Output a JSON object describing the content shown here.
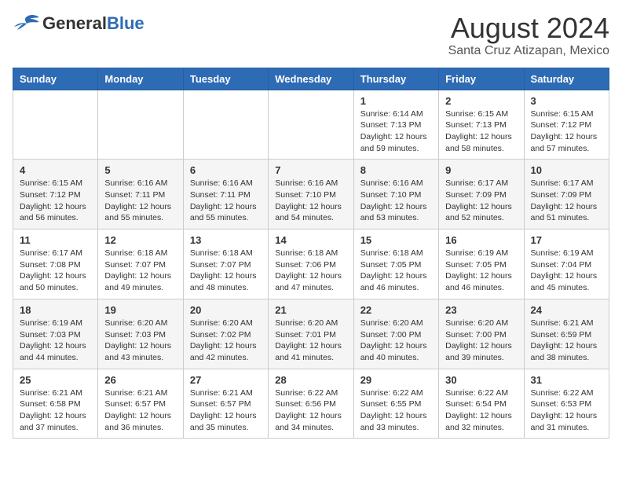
{
  "header": {
    "logo_general": "General",
    "logo_blue": "Blue",
    "month_year": "August 2024",
    "location": "Santa Cruz Atizapan, Mexico"
  },
  "weekdays": [
    "Sunday",
    "Monday",
    "Tuesday",
    "Wednesday",
    "Thursday",
    "Friday",
    "Saturday"
  ],
  "weeks": [
    [
      {
        "day": "",
        "info": ""
      },
      {
        "day": "",
        "info": ""
      },
      {
        "day": "",
        "info": ""
      },
      {
        "day": "",
        "info": ""
      },
      {
        "day": "1",
        "info": "Sunrise: 6:14 AM\nSunset: 7:13 PM\nDaylight: 12 hours\nand 59 minutes."
      },
      {
        "day": "2",
        "info": "Sunrise: 6:15 AM\nSunset: 7:13 PM\nDaylight: 12 hours\nand 58 minutes."
      },
      {
        "day": "3",
        "info": "Sunrise: 6:15 AM\nSunset: 7:12 PM\nDaylight: 12 hours\nand 57 minutes."
      }
    ],
    [
      {
        "day": "4",
        "info": "Sunrise: 6:15 AM\nSunset: 7:12 PM\nDaylight: 12 hours\nand 56 minutes."
      },
      {
        "day": "5",
        "info": "Sunrise: 6:16 AM\nSunset: 7:11 PM\nDaylight: 12 hours\nand 55 minutes."
      },
      {
        "day": "6",
        "info": "Sunrise: 6:16 AM\nSunset: 7:11 PM\nDaylight: 12 hours\nand 55 minutes."
      },
      {
        "day": "7",
        "info": "Sunrise: 6:16 AM\nSunset: 7:10 PM\nDaylight: 12 hours\nand 54 minutes."
      },
      {
        "day": "8",
        "info": "Sunrise: 6:16 AM\nSunset: 7:10 PM\nDaylight: 12 hours\nand 53 minutes."
      },
      {
        "day": "9",
        "info": "Sunrise: 6:17 AM\nSunset: 7:09 PM\nDaylight: 12 hours\nand 52 minutes."
      },
      {
        "day": "10",
        "info": "Sunrise: 6:17 AM\nSunset: 7:09 PM\nDaylight: 12 hours\nand 51 minutes."
      }
    ],
    [
      {
        "day": "11",
        "info": "Sunrise: 6:17 AM\nSunset: 7:08 PM\nDaylight: 12 hours\nand 50 minutes."
      },
      {
        "day": "12",
        "info": "Sunrise: 6:18 AM\nSunset: 7:07 PM\nDaylight: 12 hours\nand 49 minutes."
      },
      {
        "day": "13",
        "info": "Sunrise: 6:18 AM\nSunset: 7:07 PM\nDaylight: 12 hours\nand 48 minutes."
      },
      {
        "day": "14",
        "info": "Sunrise: 6:18 AM\nSunset: 7:06 PM\nDaylight: 12 hours\nand 47 minutes."
      },
      {
        "day": "15",
        "info": "Sunrise: 6:18 AM\nSunset: 7:05 PM\nDaylight: 12 hours\nand 46 minutes."
      },
      {
        "day": "16",
        "info": "Sunrise: 6:19 AM\nSunset: 7:05 PM\nDaylight: 12 hours\nand 46 minutes."
      },
      {
        "day": "17",
        "info": "Sunrise: 6:19 AM\nSunset: 7:04 PM\nDaylight: 12 hours\nand 45 minutes."
      }
    ],
    [
      {
        "day": "18",
        "info": "Sunrise: 6:19 AM\nSunset: 7:03 PM\nDaylight: 12 hours\nand 44 minutes."
      },
      {
        "day": "19",
        "info": "Sunrise: 6:20 AM\nSunset: 7:03 PM\nDaylight: 12 hours\nand 43 minutes."
      },
      {
        "day": "20",
        "info": "Sunrise: 6:20 AM\nSunset: 7:02 PM\nDaylight: 12 hours\nand 42 minutes."
      },
      {
        "day": "21",
        "info": "Sunrise: 6:20 AM\nSunset: 7:01 PM\nDaylight: 12 hours\nand 41 minutes."
      },
      {
        "day": "22",
        "info": "Sunrise: 6:20 AM\nSunset: 7:00 PM\nDaylight: 12 hours\nand 40 minutes."
      },
      {
        "day": "23",
        "info": "Sunrise: 6:20 AM\nSunset: 7:00 PM\nDaylight: 12 hours\nand 39 minutes."
      },
      {
        "day": "24",
        "info": "Sunrise: 6:21 AM\nSunset: 6:59 PM\nDaylight: 12 hours\nand 38 minutes."
      }
    ],
    [
      {
        "day": "25",
        "info": "Sunrise: 6:21 AM\nSunset: 6:58 PM\nDaylight: 12 hours\nand 37 minutes."
      },
      {
        "day": "26",
        "info": "Sunrise: 6:21 AM\nSunset: 6:57 PM\nDaylight: 12 hours\nand 36 minutes."
      },
      {
        "day": "27",
        "info": "Sunrise: 6:21 AM\nSunset: 6:57 PM\nDaylight: 12 hours\nand 35 minutes."
      },
      {
        "day": "28",
        "info": "Sunrise: 6:22 AM\nSunset: 6:56 PM\nDaylight: 12 hours\nand 34 minutes."
      },
      {
        "day": "29",
        "info": "Sunrise: 6:22 AM\nSunset: 6:55 PM\nDaylight: 12 hours\nand 33 minutes."
      },
      {
        "day": "30",
        "info": "Sunrise: 6:22 AM\nSunset: 6:54 PM\nDaylight: 12 hours\nand 32 minutes."
      },
      {
        "day": "31",
        "info": "Sunrise: 6:22 AM\nSunset: 6:53 PM\nDaylight: 12 hours\nand 31 minutes."
      }
    ]
  ]
}
